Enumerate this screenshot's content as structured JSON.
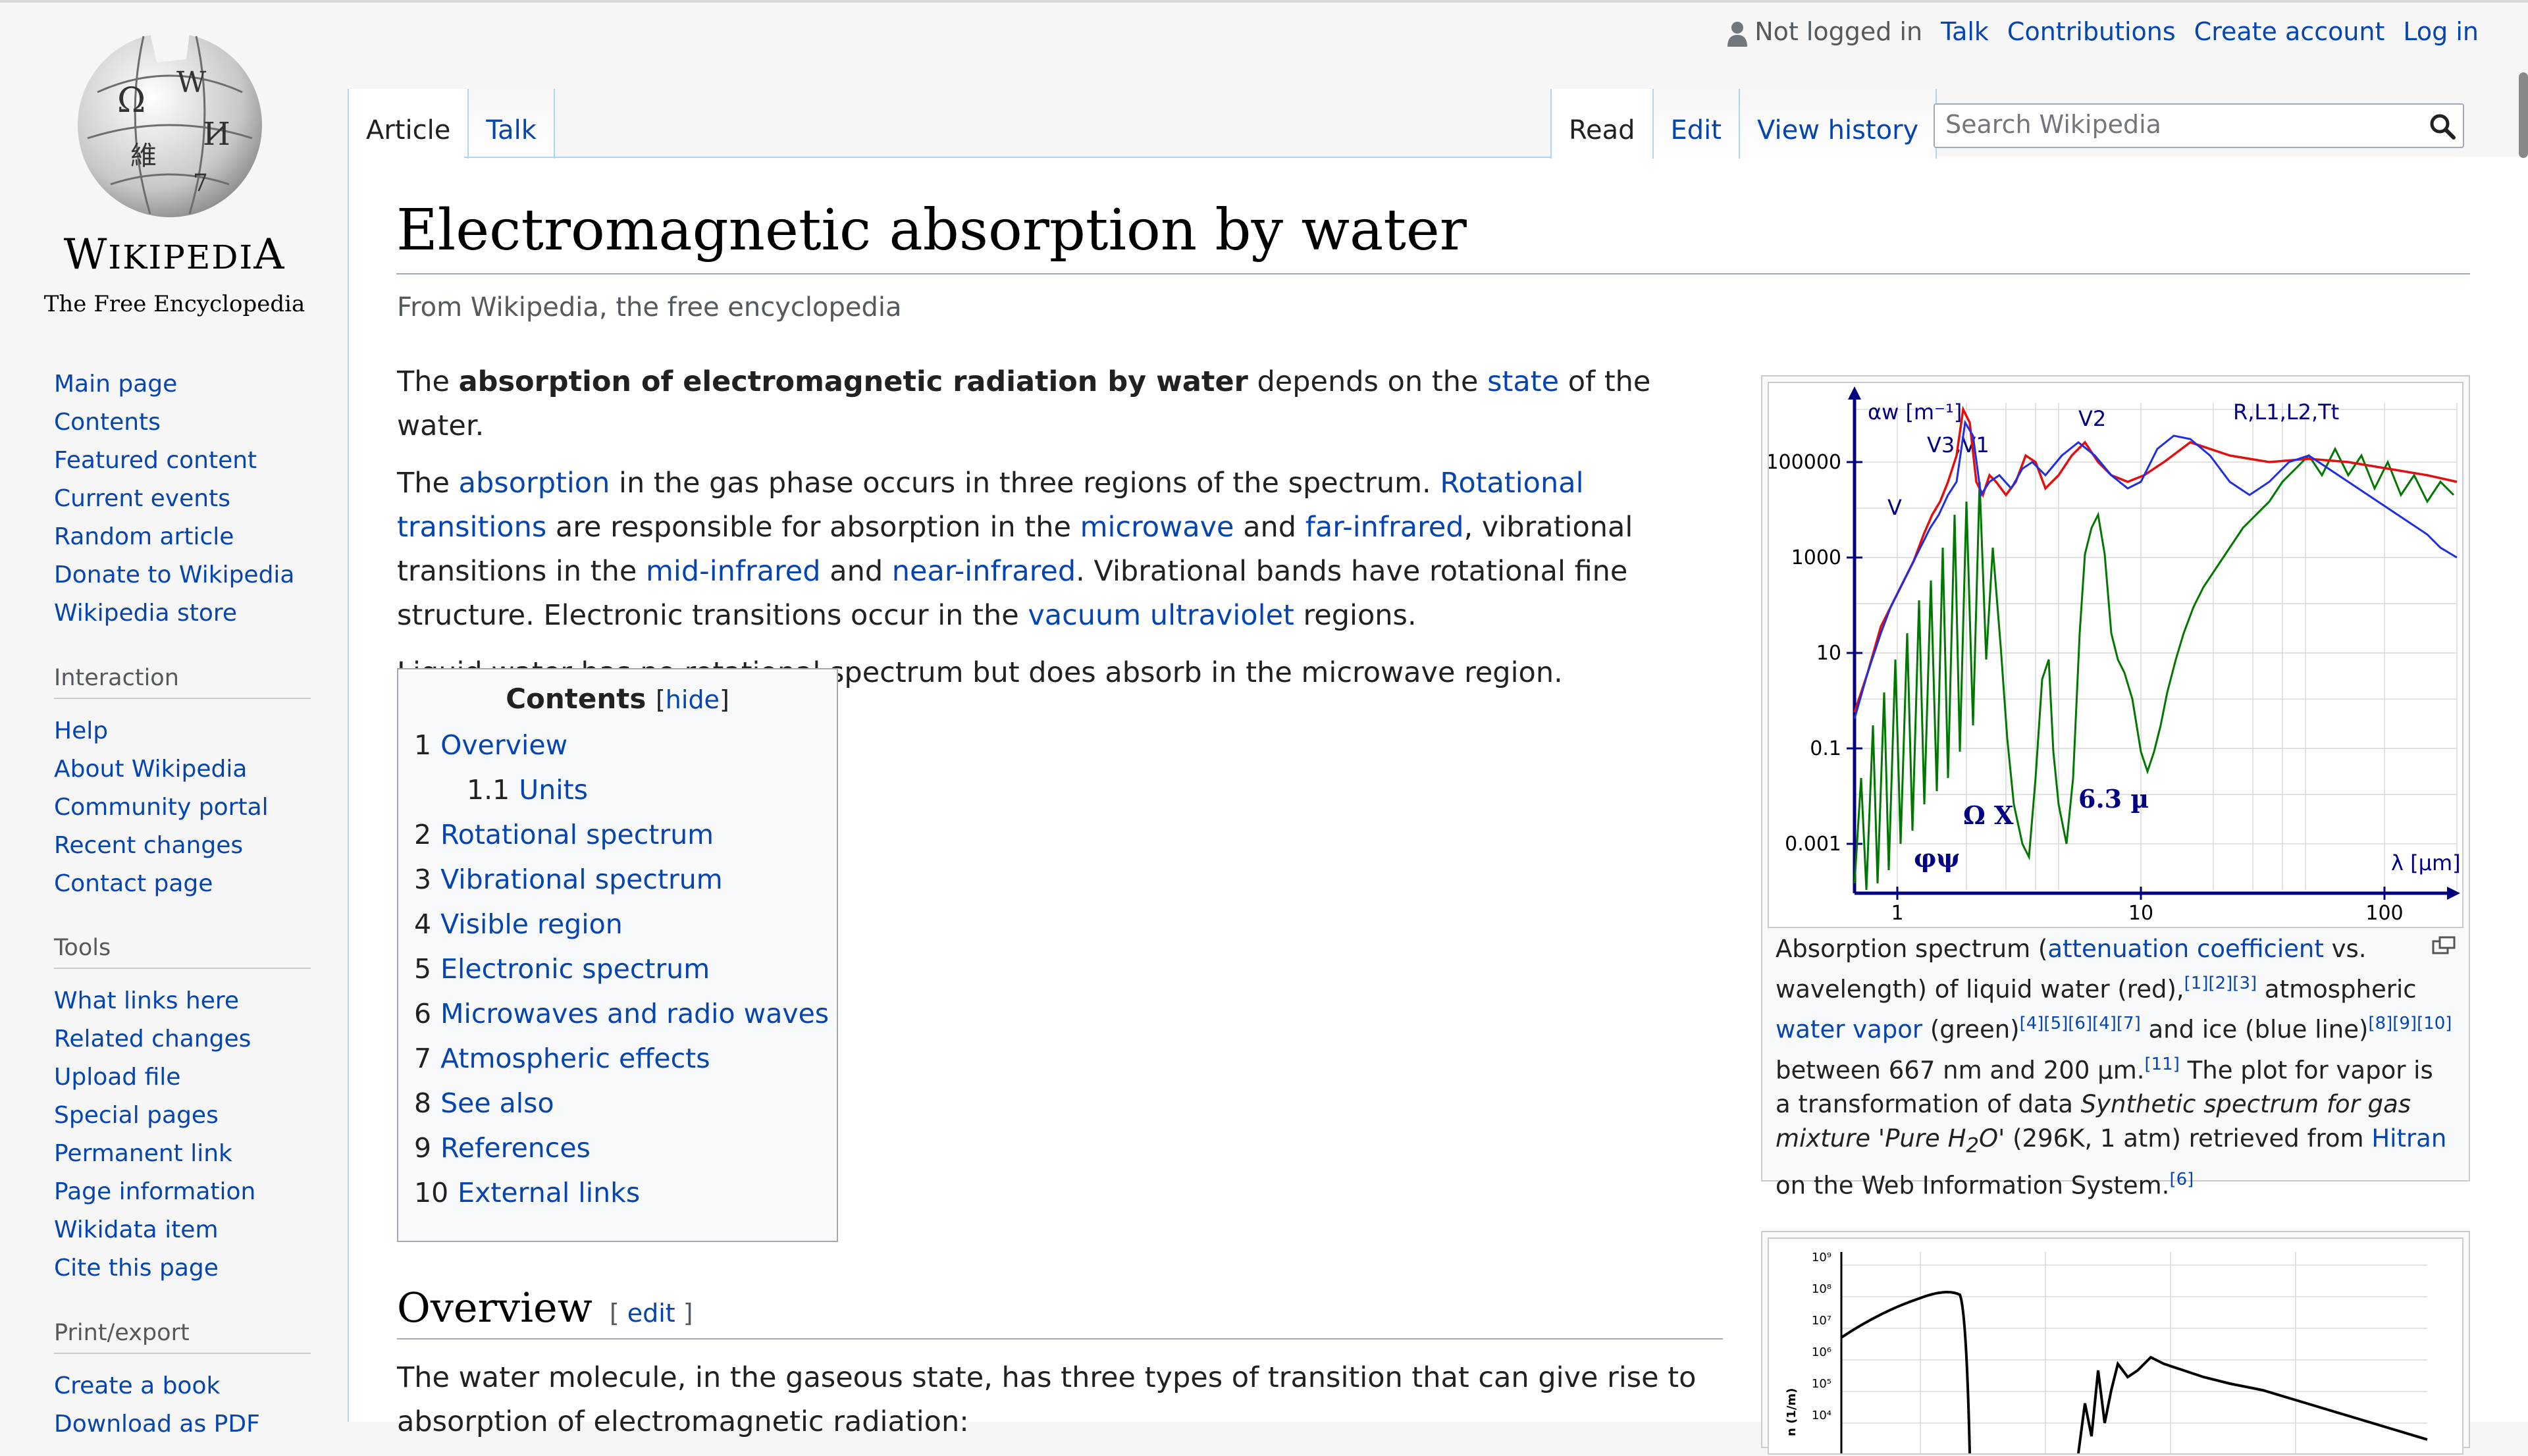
{
  "header": {
    "not_logged_in": "Not logged in",
    "links": [
      "Talk",
      "Contributions",
      "Create account",
      "Log in"
    ]
  },
  "logo": {
    "wordmark": "Wikipedia",
    "tagline": "The Free Encyclopedia",
    "globe_glyphs": [
      "Ω",
      "W",
      "И",
      "維",
      "7"
    ]
  },
  "tabs": {
    "article": "Article",
    "talk": "Talk",
    "read": "Read",
    "edit": "Edit",
    "view_history": "View history"
  },
  "search": {
    "placeholder": "Search Wikipedia"
  },
  "sidebar": {
    "navigation": [
      "Main page",
      "Contents",
      "Featured content",
      "Current events",
      "Random article",
      "Donate to Wikipedia",
      "Wikipedia store"
    ],
    "interaction": {
      "heading": "Interaction",
      "items": [
        "Help",
        "About Wikipedia",
        "Community portal",
        "Recent changes",
        "Contact page"
      ]
    },
    "tools": {
      "heading": "Tools",
      "items": [
        "What links here",
        "Related changes",
        "Upload file",
        "Special pages",
        "Permanent link",
        "Page information",
        "Wikidata item",
        "Cite this page"
      ]
    },
    "print": {
      "heading": "Print/export",
      "items": [
        "Create a book",
        "Download as PDF"
      ]
    }
  },
  "article": {
    "title": "Electromagnetic absorption by water",
    "tagline": "From Wikipedia, the free encyclopedia",
    "p1": {
      "pre": "The ",
      "bold": "absorption of electromagnetic radiation by water",
      "mid": " depends on the ",
      "link": "state",
      "post": " of the water."
    },
    "p2": {
      "t1": "The ",
      "l1": "absorption",
      "t2": " in the gas phase occurs in three regions of the spectrum. ",
      "l2": "Rotational transitions",
      "t3": " are responsible for absorption in the ",
      "l3": "microwave",
      "t4": " and ",
      "l4": "far-infrared",
      "t5": ", vibrational transitions in the ",
      "l5": "mid-infrared",
      "t6": " and ",
      "l6": "near-infrared",
      "t7": ". Vibrational bands have rotational fine structure. Electronic transitions occur in the ",
      "l7": "vacuum ultraviolet",
      "t8": " regions."
    },
    "p3": "Liquid water has no rotational spectrum but does absorb in the microwave region.",
    "toc": {
      "title": "Contents",
      "hide": "hide",
      "items": [
        {
          "num": "1",
          "label": "Overview"
        },
        {
          "num": "1.1",
          "label": "Units"
        },
        {
          "num": "2",
          "label": "Rotational spectrum"
        },
        {
          "num": "3",
          "label": "Vibrational spectrum"
        },
        {
          "num": "4",
          "label": "Visible region"
        },
        {
          "num": "5",
          "label": "Electronic spectrum"
        },
        {
          "num": "6",
          "label": "Microwaves and radio waves"
        },
        {
          "num": "7",
          "label": "Atmospheric effects"
        },
        {
          "num": "8",
          "label": "See also"
        },
        {
          "num": "9",
          "label": "References"
        },
        {
          "num": "10",
          "label": "External links"
        }
      ]
    },
    "overview": {
      "heading": "Overview",
      "edit": "edit",
      "text": "The water molecule, in the gaseous state, has three types of transition that can give rise to absorption of electromagnetic radiation:"
    },
    "figure": {
      "caption": {
        "t1": "Absorption spectrum (",
        "l1": "attenuation coefficient",
        "t2": " vs. wavelength) of liquid water (red),",
        "r1": "[1][2][3]",
        "t3": " atmospheric ",
        "l2": "water vapor",
        "t4": " (green)",
        "r2": "[4][5][6][4][7]",
        "t5": " and ice (blue line)",
        "r3": "[8][9][10]",
        "t6": " between 667 nm and 200 µm.",
        "r4": "[11]",
        "t7": " The plot for vapor is a transformation of data ",
        "i1": "Synthetic spectrum for gas mixture 'Pure H",
        "sub": "2",
        "i2": "O'",
        "t8": " (296K, 1 atm) retrieved from ",
        "l3": "Hitran",
        "t9": " on the Web Information System.",
        "r5": "[6]"
      },
      "chart_labels": {
        "y_ticks": [
          "100000",
          "1000",
          "10",
          "0.1",
          "0.001"
        ],
        "x_ticks": [
          "1",
          "10",
          "100"
        ],
        "y_axis": "αw [m⁻¹]",
        "x_axis": "λ [µm]",
        "annotations": [
          "V3,V1",
          "V2",
          "R,L1,L2,Tt",
          "V",
          "Ω X",
          "6.3 µ",
          "φψ"
        ]
      },
      "second_chart_ticks": [
        "10⁹",
        "10⁸",
        "10⁷",
        "10⁶",
        "10⁵",
        "10⁴"
      ],
      "second_chart_axis": "n (1/m)"
    }
  },
  "colors": {
    "link": "#0645ad",
    "liquid": "#e01010",
    "vapor": "#007700",
    "ice": "#1e2ee0",
    "axis": "#000080"
  }
}
